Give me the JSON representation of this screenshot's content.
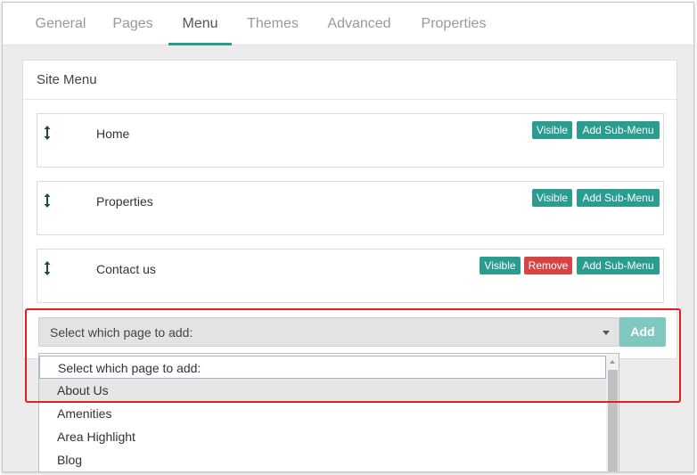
{
  "tabs": [
    "General",
    "Pages",
    "Menu",
    "Themes",
    "Advanced",
    "Properties"
  ],
  "active_tab": "Menu",
  "panel": {
    "title": "Site Menu"
  },
  "menu_items": [
    {
      "label": "Home",
      "visible_label": "Visible",
      "add_sub_label": "Add Sub-Menu"
    },
    {
      "label": "Properties",
      "visible_label": "Visible",
      "add_sub_label": "Add Sub-Menu"
    },
    {
      "label": "Contact us",
      "visible_label": "Visible",
      "remove_label": "Remove",
      "add_sub_label": "Add Sub-Menu"
    }
  ],
  "page_select": {
    "value": "Select which page to add:",
    "add_label": "Add",
    "options": [
      "Select which page to add:",
      "About Us",
      "Amenities",
      "Area Highlight",
      "Blog"
    ],
    "hovered_option": "About Us"
  },
  "colors": {
    "accent": "#2a9d8f",
    "danger": "#d64545",
    "add_button": "#7fc8c0",
    "highlight": "#e02020"
  },
  "icons": {
    "drag_handle": "vertical-double-arrow-icon",
    "select_caret": "caret-down-icon",
    "scroll_up": "scroll-up-arrow-icon"
  }
}
